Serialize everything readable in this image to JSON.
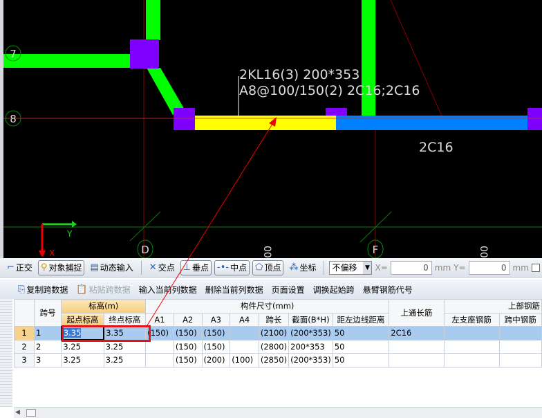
{
  "canvas": {
    "axis_labels": [
      "7",
      "8",
      "D",
      "F"
    ],
    "beam_label_line1": "2KL16(3) 200*353",
    "beam_label_line2": "A8@100/150(2) 2C16;2C16",
    "rebar_label": "2C16",
    "dim_text_1": "00",
    "dim_text_2": "00",
    "ucs_x": "X",
    "ucs_y": "Y",
    "colors": {
      "column": "#8000ff",
      "wall_beam": "#00ff00",
      "selected_beam": "#ffff00",
      "beam": "#0080ff",
      "grid": "#8b0000"
    }
  },
  "toolbar1": {
    "ortho": "正交",
    "snap": "对象捕捉",
    "dynamic_input": "动态输入",
    "intersection": "交点",
    "perpendicular": "垂点",
    "midpoint": "中点",
    "vertex": "顶点",
    "coordinate": "坐标",
    "offset_select": "不偏移",
    "x_label": "X=",
    "x_value": "0",
    "x_unit": "mm",
    "y_label": "Y=",
    "y_value": "0",
    "y_unit": "mm"
  },
  "toolbar2": {
    "copy": "复制跨数据",
    "paste": "粘贴跨数据",
    "input_col": "输入当前列数据",
    "delete_col": "删除当前列数据",
    "page_setup": "页面设置",
    "swap_start": "调换起始跨",
    "cantilever": "悬臂钢筋代号"
  },
  "table": {
    "headers": {
      "span_no": "跨号",
      "elevation": "标高(m)",
      "start_elev": "起点标高",
      "end_elev": "终点标高",
      "dimensions": "构件尺寸(mm)",
      "a1": "A1",
      "a2": "A2",
      "a3": "A3",
      "a4": "A4",
      "span_len": "跨长",
      "section": "截面(B*H)",
      "dist_left": "距左边线距离",
      "top_long": "上通长筋",
      "top_rebar": "上部钢筋",
      "left_support": "左支座钢筋",
      "mid_span": "跨中钢筋"
    },
    "rows": [
      {
        "n": "1",
        "span": "1",
        "start": "3.35",
        "end": "3.35",
        "a1": "(150)",
        "a2": "(150)",
        "a3": "(150)",
        "a4": "",
        "len": "(2100)",
        "sec": "(200*353)",
        "dist": "50",
        "top": "2C16",
        "left": "",
        "mid": ""
      },
      {
        "n": "2",
        "span": "2",
        "start": "3.25",
        "end": "3.25",
        "a1": "",
        "a2": "(150)",
        "a3": "(150)",
        "a4": "",
        "len": "(2800)",
        "sec": "200*353",
        "dist": "50",
        "top": "",
        "left": "",
        "mid": ""
      },
      {
        "n": "3",
        "span": "3",
        "start": "3.25",
        "end": "3.25",
        "a1": "",
        "a2": "(150)",
        "a3": "(200)",
        "a4": "(100)",
        "len": "(2850)",
        "sec": "(200*353)",
        "dist": "50",
        "top": "",
        "left": "",
        "mid": ""
      }
    ]
  }
}
